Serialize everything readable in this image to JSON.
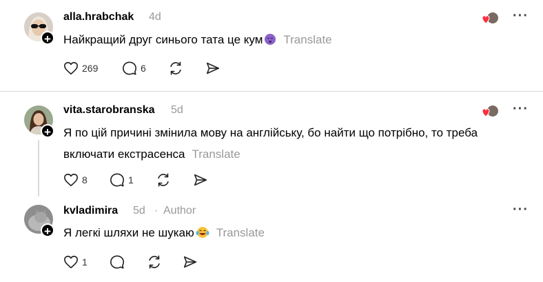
{
  "comments": [
    {
      "username": "alla.hrabchak",
      "time": "4d",
      "text": "Найкращий друг синього тата це кум",
      "emoji": "yawning-face-emoji",
      "translate_label": "Translate",
      "likes": "269",
      "replies": "6"
    },
    {
      "username": "vita.starobranska",
      "time": "5d",
      "text_line1": "Я по цій причині змінила мову на англійську, бо найти що потрібно, то треба",
      "text_line2": "включати екстрасенса",
      "translate_label": "Translate",
      "likes": "8",
      "replies": "1"
    },
    {
      "username": "kvladimira",
      "time": "5d",
      "separator": "·",
      "author_label": "Author",
      "text": "Я легкі шляхи не шукаю",
      "emoji": "laughing-tears-emoji",
      "translate_label": "Translate",
      "likes": "1",
      "replies": ""
    }
  ],
  "more_label": "···",
  "colors": {
    "muted": "#999999",
    "divider": "#d9d9d9",
    "heart": "#ff3040"
  }
}
